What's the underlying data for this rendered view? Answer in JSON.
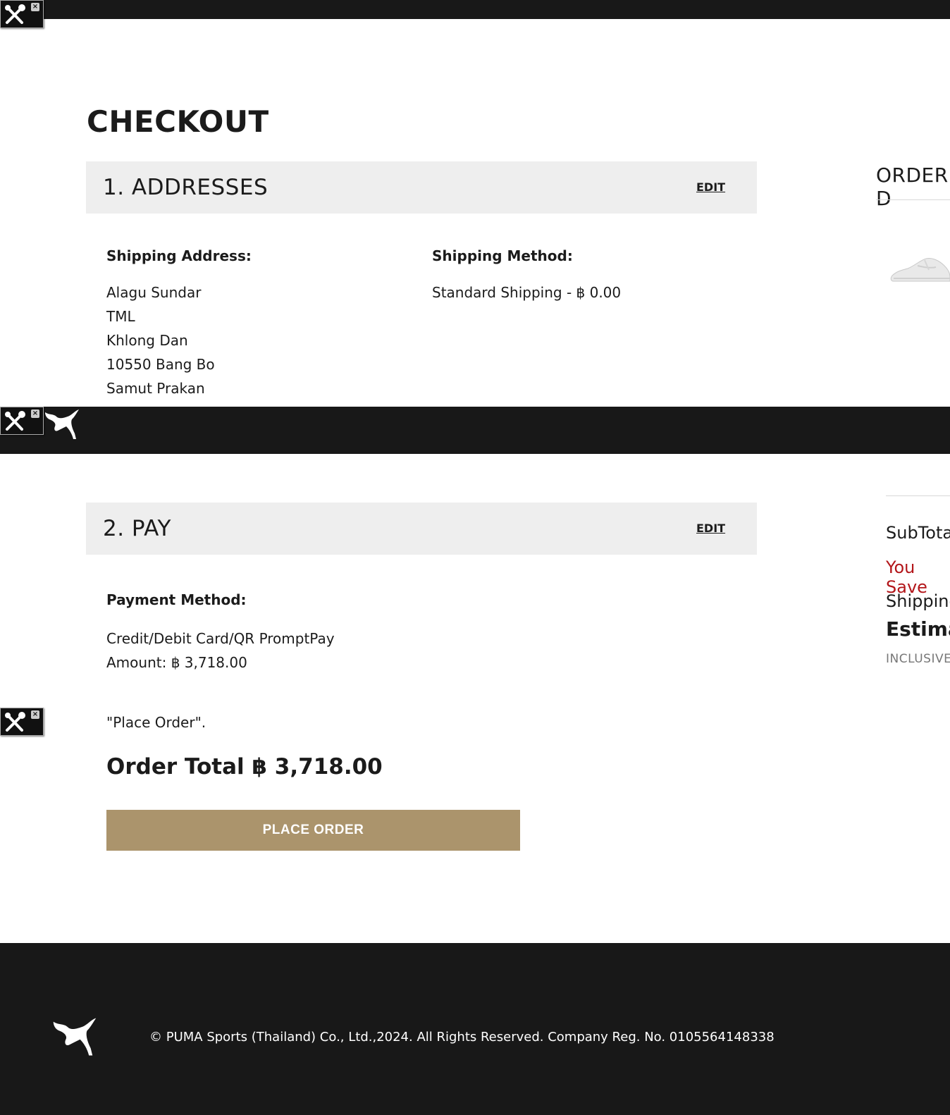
{
  "page": {
    "title": "CHECKOUT"
  },
  "addresses": {
    "heading": "1. ADDRESSES",
    "edit_label": "EDIT",
    "shipping_address_label": "Shipping Address:",
    "address_lines": [
      "Alagu Sundar",
      "TML",
      "Khlong Dan",
      "10550 Bang Bo",
      "Samut Prakan"
    ],
    "shipping_method_label": "Shipping Method:",
    "shipping_method_value": "Standard Shipping - ฿ 0.00"
  },
  "pay": {
    "heading": "2. PAY",
    "edit_label": "EDIT",
    "payment_method_label": "Payment Method:",
    "payment_method_value": "Credit/Debit Card/QR PromptPay",
    "amount_text": "Amount: ฿ 3,718.00",
    "place_order_note": "\"Place Order\".",
    "order_total": "Order Total ฿ 3,718.00",
    "place_order_button": "PLACE ORDER"
  },
  "order_summary": {
    "heading": "ORDER D",
    "subtotal_label": "SubTota",
    "you_save_label": "You Save",
    "shipping_label": "Shipping",
    "estimated_label": "Estimat",
    "inclusive_label": "INCLUSIVE"
  },
  "footer": {
    "copyright": "© PUMA Sports (Thailand) Co., Ltd.,2024. All Rights Reserved. Company Reg. No. 0105564148338"
  },
  "colors": {
    "bar_black": "#181818",
    "section_bg": "#eeeeee",
    "button_gold": "#ab946c",
    "save_red": "#b3161a"
  },
  "icons": [
    "tools-icon",
    "close-icon",
    "puma-logo-icon",
    "sneaker-image"
  ]
}
